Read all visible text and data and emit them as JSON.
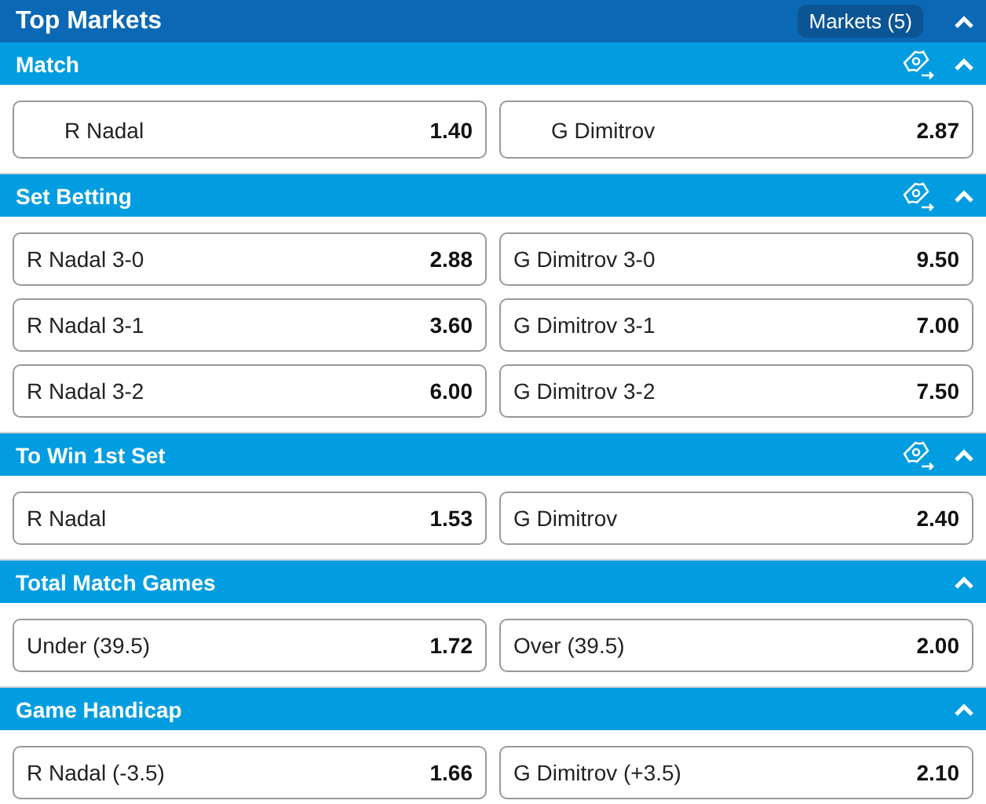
{
  "header": {
    "title": "Top Markets",
    "markets_button": "Markets (5)",
    "expanded": true
  },
  "sections": [
    {
      "title": "Match",
      "kind": "padded",
      "cashout": true,
      "expanded": true,
      "rows": [
        [
          {
            "label": "R Nadal",
            "odds": "1.40"
          },
          {
            "label": "G Dimitrov",
            "odds": "2.87"
          }
        ]
      ]
    },
    {
      "title": "Set Betting",
      "kind": "plain",
      "cashout": true,
      "expanded": true,
      "rows": [
        [
          {
            "label": "R Nadal 3-0",
            "odds": "2.88"
          },
          {
            "label": "G Dimitrov 3-0",
            "odds": "9.50"
          }
        ],
        [
          {
            "label": "R Nadal 3-1",
            "odds": "3.60"
          },
          {
            "label": "G Dimitrov 3-1",
            "odds": "7.00"
          }
        ],
        [
          {
            "label": "R Nadal 3-2",
            "odds": "6.00"
          },
          {
            "label": "G Dimitrov 3-2",
            "odds": "7.50"
          }
        ]
      ]
    },
    {
      "title": "To Win 1st Set",
      "kind": "plain",
      "cashout": true,
      "expanded": true,
      "rows": [
        [
          {
            "label": "R Nadal",
            "odds": "1.53"
          },
          {
            "label": "G Dimitrov",
            "odds": "2.40"
          }
        ]
      ]
    },
    {
      "title": "Total Match Games",
      "kind": "plain",
      "cashout": false,
      "expanded": true,
      "rows": [
        [
          {
            "label": "Under (39.5)",
            "odds": "1.72"
          },
          {
            "label": "Over (39.5)",
            "odds": "2.00"
          }
        ]
      ]
    },
    {
      "title": "Game Handicap",
      "kind": "plain",
      "cashout": false,
      "expanded": true,
      "rows": [
        [
          {
            "label": "R Nadal (-3.5)",
            "odds": "1.66"
          },
          {
            "label": "G Dimitrov (+3.5)",
            "odds": "2.10"
          }
        ]
      ]
    }
  ]
}
